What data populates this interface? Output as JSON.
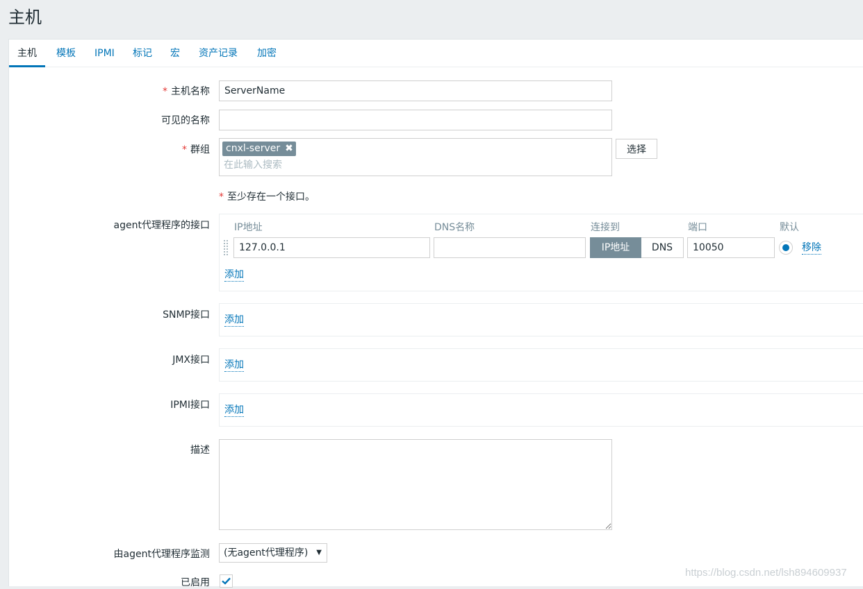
{
  "page": {
    "title": "主机"
  },
  "tabs": [
    {
      "label": "主机",
      "active": true
    },
    {
      "label": "模板"
    },
    {
      "label": "IPMI"
    },
    {
      "label": "标记"
    },
    {
      "label": "宏"
    },
    {
      "label": "资产记录"
    },
    {
      "label": "加密"
    }
  ],
  "form": {
    "required_mark": "*",
    "host_name": {
      "label": "主机名称",
      "value": "ServerName"
    },
    "visible_name": {
      "label": "可见的名称",
      "value": ""
    },
    "groups": {
      "label": "群组",
      "selected": [
        "cnxl-server"
      ],
      "remove_icon": "✖",
      "placeholder": "在此输入搜索",
      "select_button": "选择"
    },
    "interface_hint": "至少存在一个接口。",
    "agent_interfaces": {
      "label": "agent代理程序的接口",
      "columns": {
        "ip": "IP地址",
        "dns": "DNS名称",
        "connect": "连接到",
        "port": "端口",
        "default": "默认"
      },
      "row": {
        "ip": "127.0.0.1",
        "dns": "",
        "connect_options": [
          "IP地址",
          "DNS"
        ],
        "connect_selected": "IP地址",
        "port": "10050",
        "remove_label": "移除"
      },
      "add_label": "添加"
    },
    "snmp_interfaces": {
      "label": "SNMP接口",
      "add_label": "添加"
    },
    "jmx_interfaces": {
      "label": "JMX接口",
      "add_label": "添加"
    },
    "ipmi_interfaces": {
      "label": "IPMI接口",
      "add_label": "添加"
    },
    "description": {
      "label": "描述",
      "value": ""
    },
    "monitored_by_proxy": {
      "label": "由agent代理程序监测",
      "selected": "(无agent代理程序)",
      "arrow": "▼"
    },
    "enabled": {
      "label": "已启用",
      "checked": true
    }
  },
  "watermark": "https://blog.csdn.net/lsh894609937",
  "colors": {
    "link": "#0275b8",
    "required": "#e33734",
    "tag_bg": "#768d99"
  }
}
